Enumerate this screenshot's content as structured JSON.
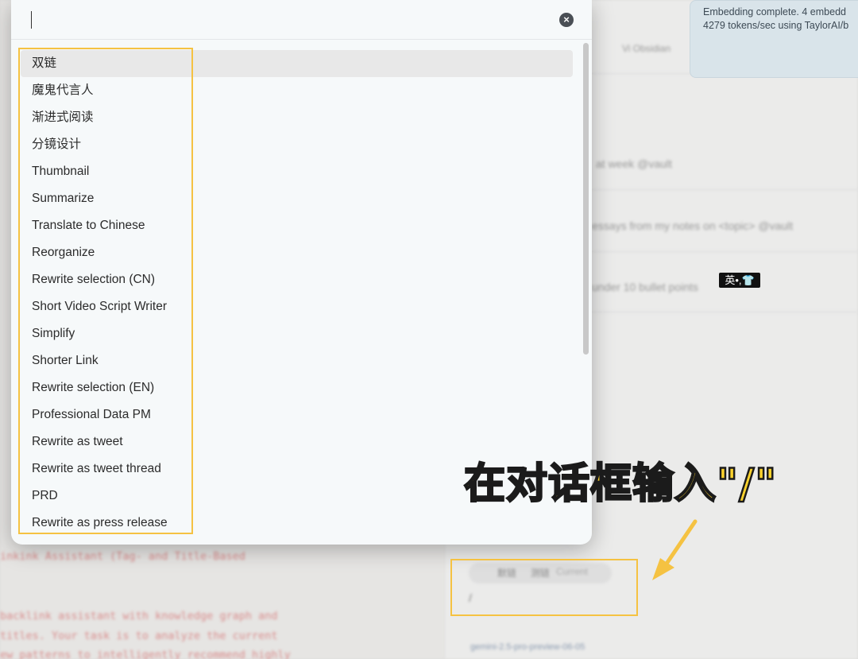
{
  "modal": {
    "search_placeholder": "",
    "search_value": "",
    "close_glyph": "×",
    "commands": [
      {
        "label": "双链",
        "active": true
      },
      {
        "label": "魔鬼代言人"
      },
      {
        "label": "渐进式阅读"
      },
      {
        "label": "分镜设计"
      },
      {
        "label": "Thumbnail"
      },
      {
        "label": "Summarize"
      },
      {
        "label": "Translate to Chinese"
      },
      {
        "label": "Reorganize"
      },
      {
        "label": "Rewrite selection (CN)"
      },
      {
        "label": "Short Video Script Writer"
      },
      {
        "label": "Simplify"
      },
      {
        "label": "Shorter Link"
      },
      {
        "label": "Rewrite selection (EN)"
      },
      {
        "label": "Professional Data PM"
      },
      {
        "label": "Rewrite as tweet"
      },
      {
        "label": "Rewrite as tweet thread"
      },
      {
        "label": "PRD"
      },
      {
        "label": "Rewrite as press release"
      }
    ]
  },
  "notice": {
    "line1": "Embedding complete. 4 embedd",
    "line2": "4279 tokens/sec using TaylorAI/b"
  },
  "background": {
    "ghost_1": "Vi Obsidian",
    "ghost_2": "at week @vault",
    "ghost_3": "essays from my notes on <topic> @vault",
    "ghost_4": "under 10 bullet points",
    "code_1": "inkink Assistant (Tag- and Title-Based",
    "code_2": "backlink assistant with knowledge graph and",
    "code_3": "titles. Your task is to analyze the current",
    "code_4": "ew patterns to intelligently recommend highly",
    "chip_1": "默链",
    "chip_2": "测链",
    "chip_3": "Current",
    "slash": "/",
    "model": "gemini-2.5-pro-preview-06-05"
  },
  "ime_badge": "英•,👕",
  "annotation": {
    "callout": "在对话框输入\"/\"",
    "colors": {
      "highlight": "#f5c242",
      "callout_fill": "#fbd22d"
    }
  }
}
